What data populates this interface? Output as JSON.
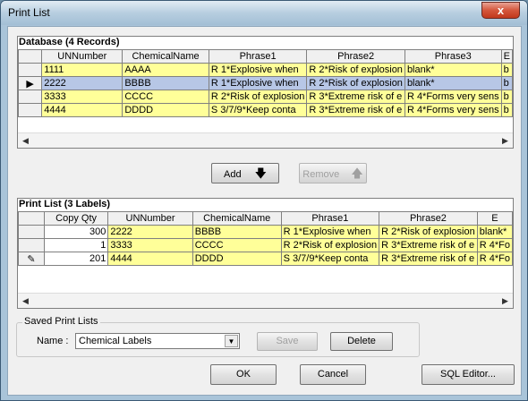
{
  "window": {
    "title": "Print List",
    "close_glyph": "x"
  },
  "database": {
    "caption": "Database (4 Records)",
    "columns": [
      "UNNumber",
      "ChemicalName",
      "Phrase1",
      "Phrase2",
      "Phrase3",
      "E"
    ],
    "rows": [
      {
        "indicator": "",
        "cells": [
          "1111",
          "AAAA",
          "R 1*Explosive when",
          "R 2*Risk of explosion",
          "blank*",
          "b"
        ]
      },
      {
        "indicator": "▶",
        "cells": [
          "2222",
          "BBBB",
          "R 1*Explosive when",
          "R 2*Risk of explosion",
          "blank*",
          "b"
        ]
      },
      {
        "indicator": "",
        "cells": [
          "3333",
          "CCCC",
          "R 2*Risk of explosion",
          "R 3*Extreme risk of e",
          "R 4*Forms very sens",
          "b"
        ]
      },
      {
        "indicator": "",
        "cells": [
          "4444",
          "DDDD",
          "S 3/7/9*Keep conta",
          "R 3*Extreme risk of e",
          "R 4*Forms very sens",
          "b"
        ]
      }
    ]
  },
  "buttons": {
    "add": "Add",
    "remove": "Remove",
    "ok": "OK",
    "cancel": "Cancel",
    "sql": "SQL Editor...",
    "save": "Save",
    "delete": "Delete"
  },
  "print_list": {
    "caption": "Print List (3 Labels)",
    "columns": [
      "Copy Qty",
      "UNNumber",
      "ChemicalName",
      "Phrase1",
      "Phrase2",
      "E"
    ],
    "rows": [
      {
        "indicator": "",
        "cells": [
          "300",
          "2222",
          "BBBB",
          "R 1*Explosive when",
          "R 2*Risk of explosion",
          "blank*"
        ]
      },
      {
        "indicator": "",
        "cells": [
          "1",
          "3333",
          "CCCC",
          "R 2*Risk of explosion",
          "R 3*Extreme risk of e",
          "R 4*Fo"
        ]
      },
      {
        "indicator": "✎",
        "cells": [
          "201",
          "4444",
          "DDDD",
          "S 3/7/9*Keep conta",
          "R 3*Extreme risk of e",
          "R 4*Fo"
        ]
      }
    ]
  },
  "saved": {
    "group_label": "Saved Print Lists",
    "name_label": "Name :",
    "name_value": "Chemical Labels"
  },
  "icons": {
    "down_arrow": "down-arrow-icon",
    "up_arrow": "up-arrow-icon"
  }
}
